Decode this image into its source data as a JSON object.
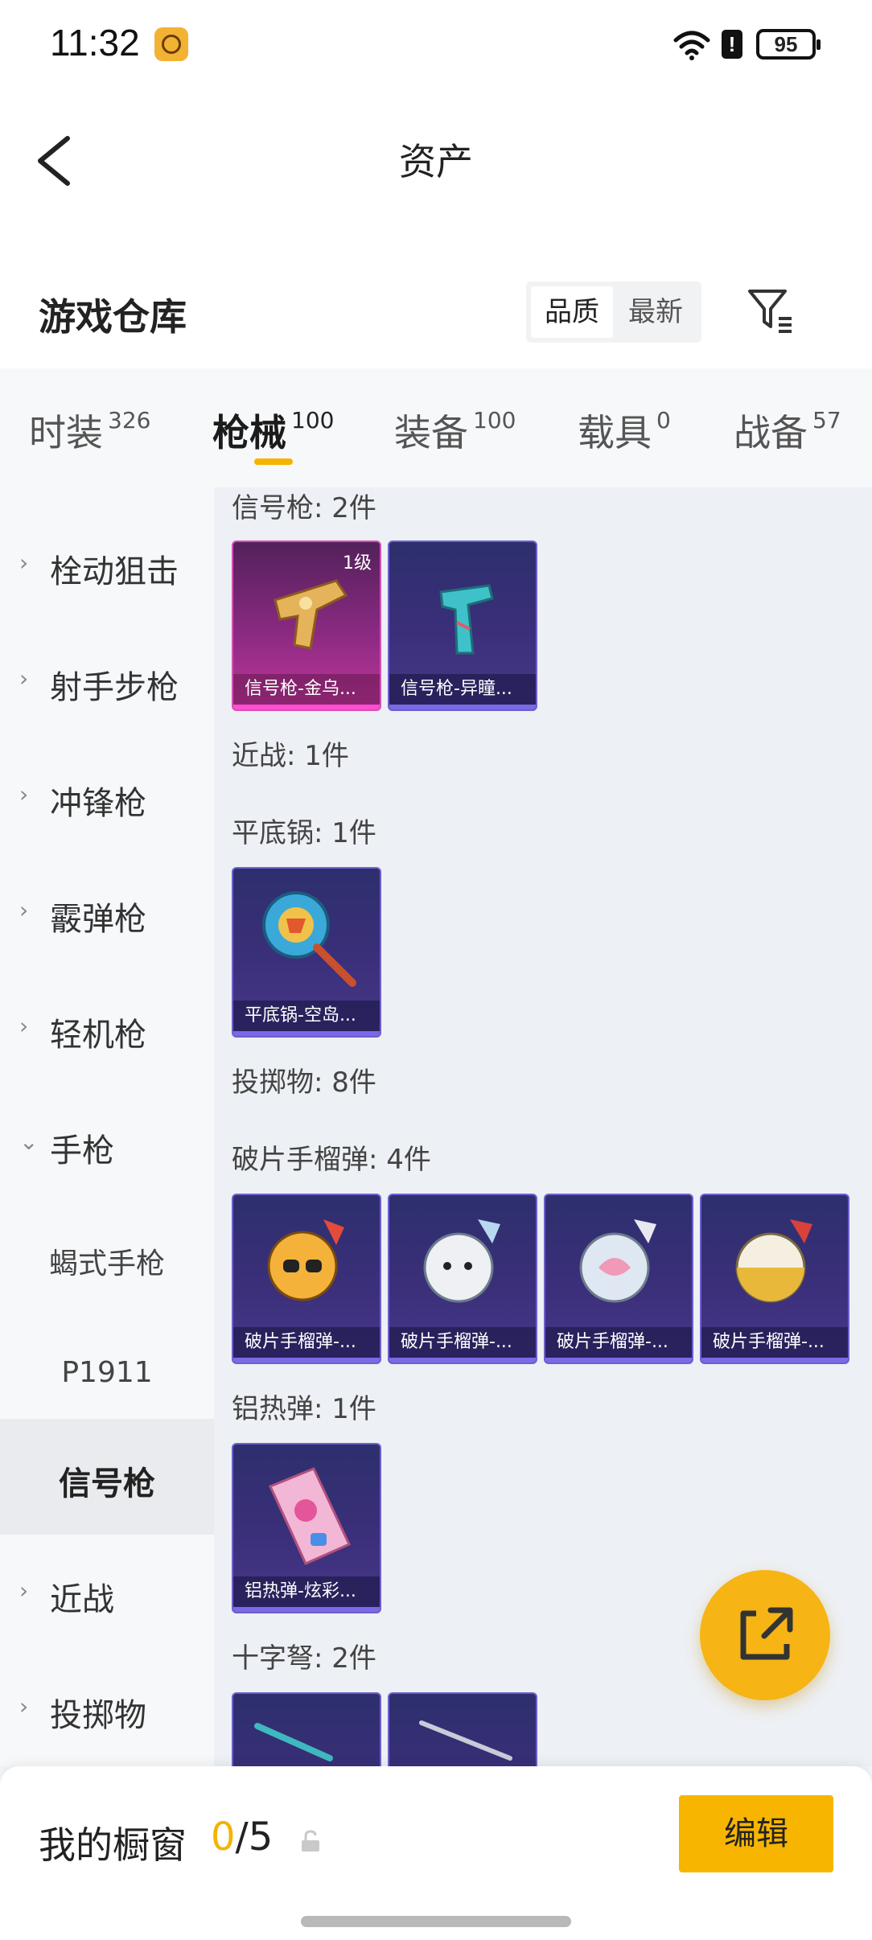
{
  "status_bar": {
    "time": "11:32",
    "battery": "95",
    "alert": "!"
  },
  "header": {
    "title": "资产"
  },
  "warehouse": {
    "title": "游戏仓库",
    "sort_options": [
      "品质",
      "最新"
    ]
  },
  "tabs": [
    {
      "label": "时装",
      "count": "326"
    },
    {
      "label": "枪械",
      "count": "100"
    },
    {
      "label": "装备",
      "count": "100"
    },
    {
      "label": "载具",
      "count": "0"
    },
    {
      "label": "战备",
      "count": "57"
    }
  ],
  "sidebar": {
    "items": [
      {
        "label": "栓动狙击",
        "chevron": "›"
      },
      {
        "label": "射手步枪",
        "chevron": "›"
      },
      {
        "label": "冲锋枪",
        "chevron": "›"
      },
      {
        "label": "霰弹枪",
        "chevron": "›"
      },
      {
        "label": "轻机枪",
        "chevron": "›"
      },
      {
        "label": "手枪",
        "chevron": "⌄"
      },
      {
        "label": "蝎式手枪"
      },
      {
        "label": "P1911"
      },
      {
        "label": "信号枪"
      },
      {
        "label": "近战",
        "chevron": "›"
      },
      {
        "label": "投掷物",
        "chevron": "›"
      }
    ]
  },
  "content": {
    "sections": {
      "flare_gun": "信号枪: 2件",
      "melee": "近战: 1件",
      "pan": "平底锅: 1件",
      "throwables": "投掷物: 8件",
      "frag": "破片手榴弹: 4件",
      "thermite": "铝热弹: 1件",
      "crossbow": "十字弩: 2件"
    },
    "cards": {
      "flare_1": {
        "name": "信号枪-金乌...",
        "level": "1级"
      },
      "flare_2": {
        "name": "信号枪-异瞳..."
      },
      "pan_1": {
        "name": "平底锅-空岛..."
      },
      "frag_1": {
        "name": "破片手榴弹-..."
      },
      "frag_2": {
        "name": "破片手榴弹-..."
      },
      "frag_3": {
        "name": "破片手榴弹-..."
      },
      "frag_4": {
        "name": "破片手榴弹-..."
      },
      "thermite_1": {
        "name": "铝热弹-炫彩..."
      }
    }
  },
  "showcase": {
    "label": "我的橱窗",
    "current": "0",
    "total": "/5",
    "edit_label": "编辑"
  },
  "colors": {
    "accent": "#f5b300",
    "card_purple": "#3b2f7a",
    "card_gold": "#c2379c"
  }
}
